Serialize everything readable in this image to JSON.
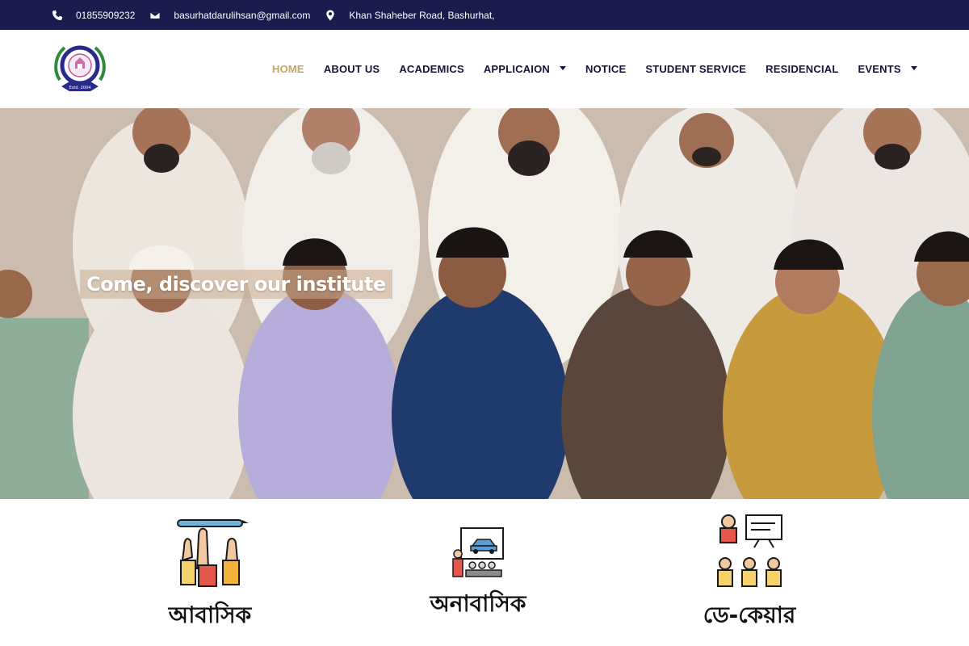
{
  "topbar": {
    "phone": "01855909232",
    "email": "basurhatdarulihsan@gmail.com",
    "address": "Khan Shaheber Road, Bashurhat,",
    "icons": [
      "phone-icon",
      "envelope-icon",
      "map-marker-icon"
    ],
    "background": "#1b1b4d"
  },
  "header": {
    "logo_text": "BASHURHAT DARUL IHSAN MADRASAH",
    "logo_est": "Estd. 2004",
    "nav": [
      {
        "label": "HOME",
        "active": true
      },
      {
        "label": "ABOUT US"
      },
      {
        "label": "ACADEMICS"
      },
      {
        "label": "APPLICAION",
        "dropdown": true
      },
      {
        "label": "NOTICE"
      },
      {
        "label": "STUDENT SERVICE"
      },
      {
        "label": "RESIDENCIAL"
      },
      {
        "label": "EVENTS",
        "dropdown": true
      }
    ],
    "active_color": "#c9a36a"
  },
  "hero": {
    "title": "Come, discover our institute"
  },
  "features": [
    {
      "label": "আবাসিক",
      "icon": "raised-hands-icon"
    },
    {
      "label": "অনাবাসিক",
      "icon": "classroom-presentation-icon"
    },
    {
      "label": "ডে-কেয়ার",
      "icon": "teacher-students-icon"
    }
  ]
}
